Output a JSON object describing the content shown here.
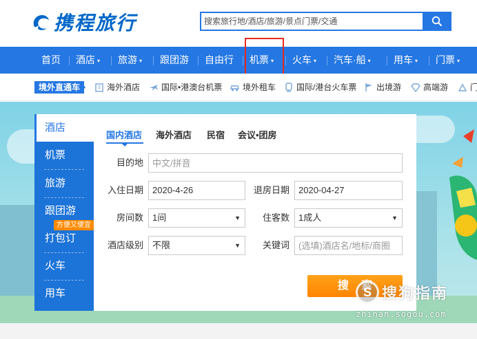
{
  "header": {
    "logo_text": "携程旅行",
    "search_placeholder": "搜索旅行地/酒店/旅游/景点门票/交通"
  },
  "main_nav": {
    "items": [
      {
        "label": "首页",
        "dropdown": false
      },
      {
        "label": "酒店",
        "dropdown": true
      },
      {
        "label": "旅游",
        "dropdown": true
      },
      {
        "label": "跟团游",
        "dropdown": false
      },
      {
        "label": "自由行",
        "dropdown": false
      },
      {
        "label": "机票",
        "dropdown": true,
        "highlighted": true
      },
      {
        "label": "火车",
        "dropdown": true
      },
      {
        "label": "汽车·船",
        "dropdown": true
      },
      {
        "label": "用车",
        "dropdown": true
      },
      {
        "label": "门票",
        "dropdown": true
      }
    ],
    "caret": "▾"
  },
  "sub_nav": {
    "tag": "境外直通车",
    "items": [
      {
        "label": "海外酒店",
        "icon": "hotel-icon"
      },
      {
        "label": "国际•港澳台机票",
        "icon": "plane-icon"
      },
      {
        "label": "境外租车",
        "icon": "car-icon"
      },
      {
        "label": "国际/港台火车票",
        "icon": "train-icon"
      },
      {
        "label": "出境游",
        "icon": "flag-icon"
      },
      {
        "label": "高端游",
        "icon": "diamond-icon"
      },
      {
        "label": "门",
        "icon": "ticket-icon"
      }
    ]
  },
  "left_menu": {
    "items": [
      {
        "label": "酒店",
        "active": true
      },
      {
        "label": "机票"
      },
      {
        "label": "旅游"
      },
      {
        "label": "跟团游"
      },
      {
        "label": "打包订"
      },
      {
        "label": "火车"
      },
      {
        "label": "用车"
      }
    ],
    "badge": "方便又便宜"
  },
  "booking": {
    "tabs": [
      {
        "label": "国内酒店",
        "active": true
      },
      {
        "label": "海外酒店"
      },
      {
        "label": "民宿"
      },
      {
        "label": "会议•团房"
      }
    ],
    "destination_label": "目的地",
    "destination_placeholder": "中文/拼音",
    "checkin_label": "入住日期",
    "checkin_value": "2020-4-26",
    "checkout_label": "退房日期",
    "checkout_value": "2020-04-27",
    "rooms_label": "房间数",
    "rooms_value": "1间",
    "guests_label": "住客数",
    "guests_value": "1成人",
    "level_label": "酒店级别",
    "level_value": "不限",
    "keyword_label": "关键词",
    "keyword_placeholder": "(选填)酒店名/地标/商圈",
    "submit_label": "搜索"
  },
  "watermark": {
    "text": "搜狗指南",
    "url": "zhinan.sogou.com",
    "mark": "S"
  },
  "colors": {
    "brand_blue": "#2577e3",
    "menu_blue": "#1c73d8",
    "orange": "#ff8a00",
    "highlight_red": "#e8291e"
  }
}
